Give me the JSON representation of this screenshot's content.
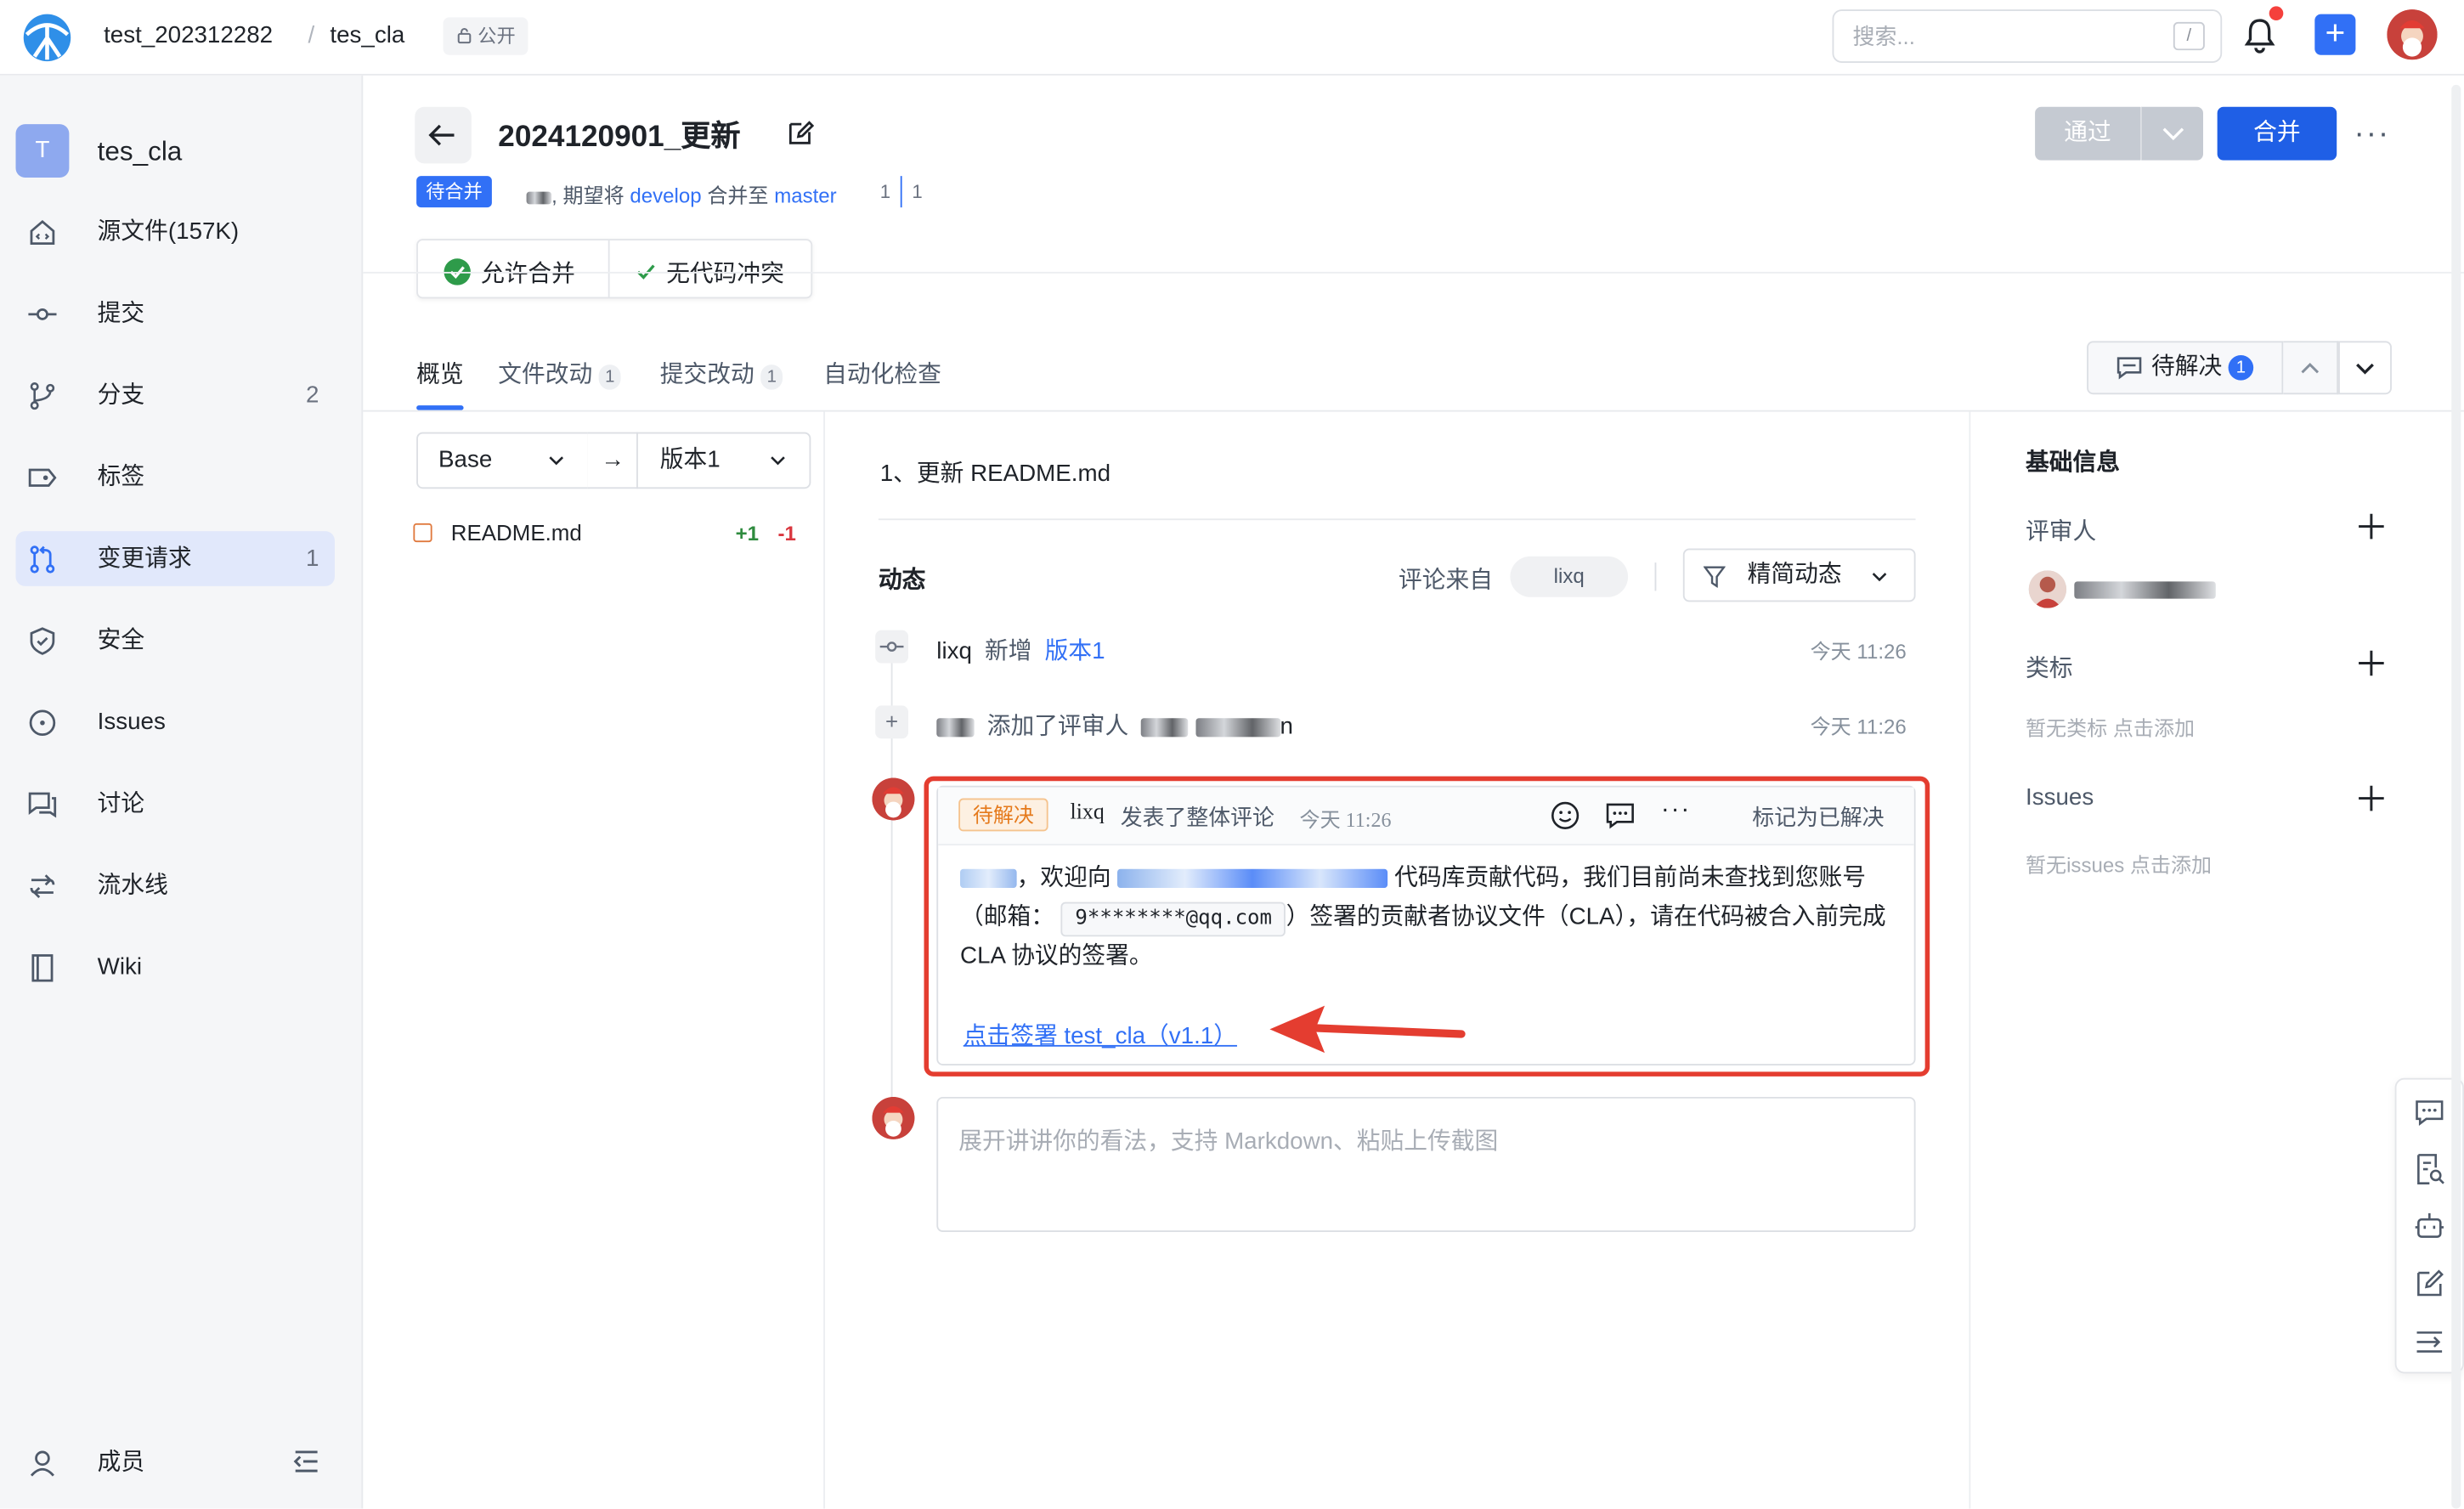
{
  "header": {
    "org": "test_202312282",
    "separator": "/",
    "repo": "tes_cla",
    "visibility": "公开",
    "search_placeholder": "搜索...",
    "search_shortcut": "/"
  },
  "sidebar": {
    "repo_initial": "T",
    "repo_name": "tes_cla",
    "items": [
      {
        "label": "源文件(157K)",
        "icon": "home-code-icon",
        "count": ""
      },
      {
        "label": "提交",
        "icon": "commit-icon",
        "count": ""
      },
      {
        "label": "分支",
        "icon": "branch-icon",
        "count": "2"
      },
      {
        "label": "标签",
        "icon": "tag-icon",
        "count": ""
      },
      {
        "label": "变更请求",
        "icon": "pull-request-icon",
        "count": "1"
      },
      {
        "label": "安全",
        "icon": "shield-icon",
        "count": ""
      },
      {
        "label": "Issues",
        "icon": "issue-icon",
        "count": ""
      },
      {
        "label": "讨论",
        "icon": "discussion-icon",
        "count": ""
      },
      {
        "label": "流水线",
        "icon": "pipeline-icon",
        "count": ""
      },
      {
        "label": "Wiki",
        "icon": "book-icon",
        "count": ""
      }
    ],
    "members_label": "成员"
  },
  "pr": {
    "title": "2024120901_更新",
    "status": "待合并",
    "sub_prefix": ", 期望将",
    "source_branch": "develop",
    "merge_to": "合并至",
    "target_branch": "master",
    "diff_left": "1",
    "diff_right": "1",
    "approve_label": "通过",
    "merge_label": "合并",
    "check_allow": "允许合并",
    "check_conflict": "无代码冲突"
  },
  "tabs": [
    {
      "label": "概览",
      "count": ""
    },
    {
      "label": "文件改动",
      "count": "1"
    },
    {
      "label": "提交改动",
      "count": "1"
    },
    {
      "label": "自动化检查",
      "count": ""
    }
  ],
  "pending": {
    "label": "待解决",
    "count": "1"
  },
  "compare": {
    "base": "Base",
    "arrow": "→",
    "version": "版本1"
  },
  "files": [
    {
      "name": "README.md",
      "added": "+1",
      "removed": "-1"
    }
  ],
  "overview": {
    "description": "1、更新 README.md",
    "activity_title": "动态",
    "comment_from": "评论来自",
    "from_user": "lixq",
    "filter_label": "精简动态"
  },
  "events": [
    {
      "user": "lixq",
      "action": "新增",
      "target": "版本1",
      "time": "今天 11:26"
    },
    {
      "user": "",
      "action": "添加了评审人",
      "target": "n",
      "time": "今天 11:26"
    }
  ],
  "comment": {
    "tag": "待解决",
    "user": "lixq",
    "action": "发表了整体评论",
    "time": "今天 11:26",
    "resolve": "标记为已解决",
    "body_1": "，欢迎向",
    "body_2": "代码库贡献代码，我们目前尚未查找到您账号（邮箱：",
    "email": "9********@qq.com",
    "body_3": "）签署的贡献者协议文件（CLA），请在代码被合入前完成 CLA 协议的签署。",
    "sign_link": "点击签署 test_cla（v1.1）"
  },
  "reply_placeholder": "展开讲讲你的看法，支持 Markdown、粘贴上传截图",
  "right_panel": {
    "title": "基础信息",
    "reviewers_label": "评审人",
    "labels_label": "类标",
    "labels_empty": "暂无类标 点击添加",
    "issues_label": "Issues",
    "issues_empty": "暂无issues 点击添加"
  },
  "colors": {
    "accent": "#3170f6",
    "highlight_box": "#e43d30",
    "pending_tag": "#e57a1c"
  }
}
